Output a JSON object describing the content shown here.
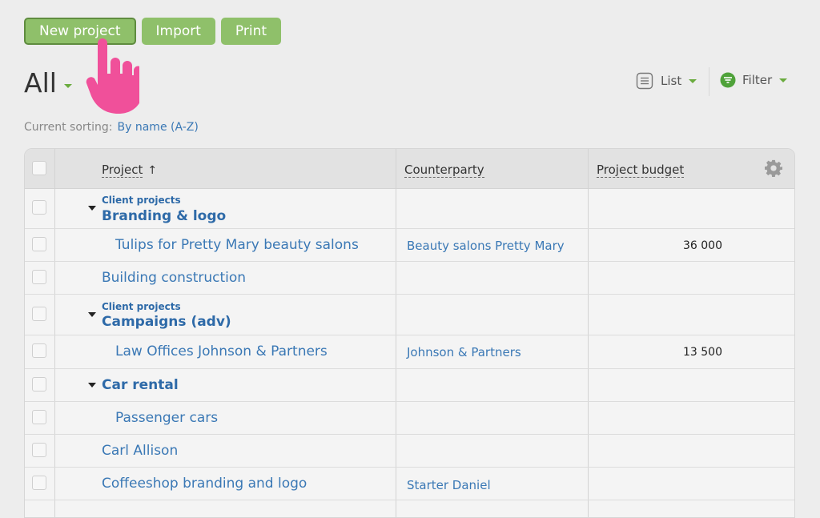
{
  "toolbar": {
    "new_project": "New project",
    "import": "Import",
    "print": "Print"
  },
  "header": {
    "title": "All",
    "view_label": "List",
    "filter_label": "Filter"
  },
  "sorting": {
    "label": "Current sorting:",
    "value": "By name (A-Z)"
  },
  "columns": {
    "project": "Project",
    "project_sort": "↑",
    "counterparty": "Counterparty",
    "budget": "Project budget"
  },
  "rows": [
    {
      "group": "Client projects",
      "name": "Branding & logo",
      "counterparty": "",
      "budget": ""
    },
    {
      "name": "Tulips for Pretty Mary beauty salons",
      "counterparty": "Beauty salons Pretty Mary",
      "budget": "36 000"
    },
    {
      "name": "Building construction",
      "counterparty": "",
      "budget": ""
    },
    {
      "group": "Client projects",
      "name": "Campaigns (adv)",
      "counterparty": "",
      "budget": ""
    },
    {
      "name": "Law Offices Johnson & Partners",
      "counterparty": "Johnson & Partners",
      "budget": "13 500"
    },
    {
      "name": "Car rental",
      "counterparty": "",
      "budget": ""
    },
    {
      "name": "Passenger cars",
      "counterparty": "",
      "budget": ""
    },
    {
      "name": "Carl Allison",
      "counterparty": "",
      "budget": ""
    },
    {
      "name": "Coffeeshop branding and logo",
      "counterparty": "Starter Daniel",
      "budget": ""
    }
  ],
  "colors": {
    "button_green": "#8fc06a",
    "link_blue": "#3a78b5",
    "pointer_pink": "#f0509a"
  }
}
